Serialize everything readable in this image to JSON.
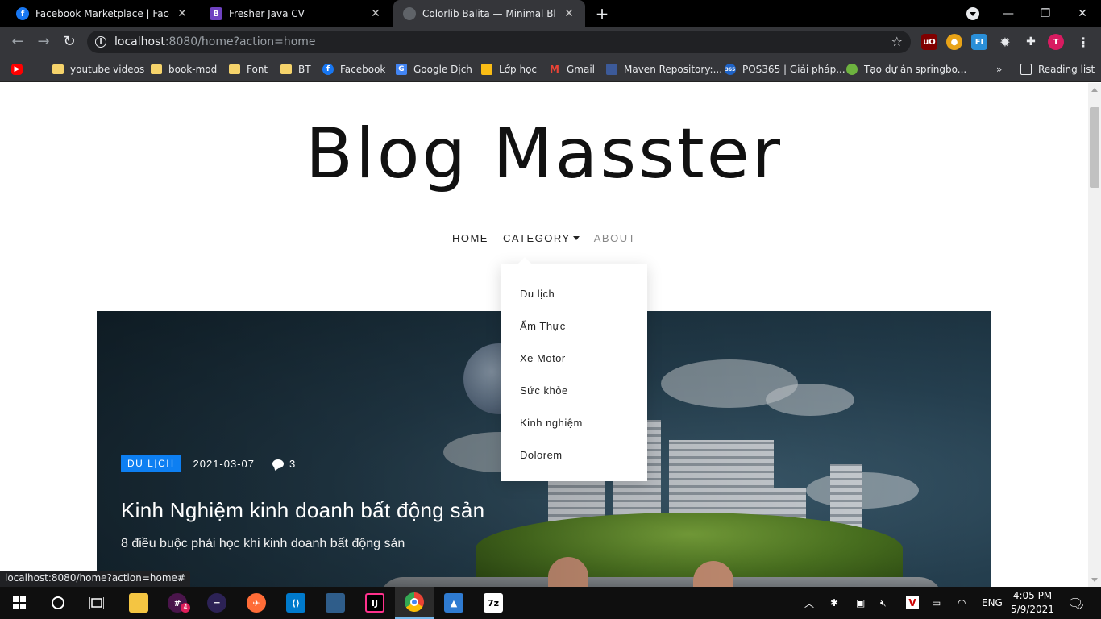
{
  "browser": {
    "tabs": [
      {
        "title": "Facebook Marketplace | Facebook",
        "icon": "facebook-icon",
        "color": "#1877f2",
        "glyph": "f",
        "active": false
      },
      {
        "title": "Fresher Java CV",
        "icon": "bootstrap-icon",
        "color": "#6f42c1",
        "glyph": "B",
        "active": false
      },
      {
        "title": "Colorlib Balita — Minimal Blog Template",
        "icon": "globe-icon",
        "color": "#5f6368",
        "glyph": "",
        "active": true
      }
    ],
    "url_host": "localhost",
    "url_rest": ":8080/home?action=home",
    "bookmarks": [
      {
        "label": "",
        "icon": "youtube-icon"
      },
      {
        "label": "youtube videos",
        "icon": "folder-icon"
      },
      {
        "label": "book-mod",
        "icon": "folder-icon"
      },
      {
        "label": "Font",
        "icon": "folder-icon"
      },
      {
        "label": "BT",
        "icon": "folder-icon"
      },
      {
        "label": "Facebook",
        "icon": "facebook-icon"
      },
      {
        "label": "Google Dịch",
        "icon": "google-translate-icon"
      },
      {
        "label": "Lớp học",
        "icon": "classroom-icon"
      },
      {
        "label": "Gmail",
        "icon": "gmail-icon"
      },
      {
        "label": "Maven Repository:...",
        "icon": "maven-icon"
      },
      {
        "label": "POS365 | Giải pháp...",
        "icon": "pos365-icon"
      },
      {
        "label": "Tạo dự án springbo...",
        "icon": "spring-icon"
      }
    ],
    "more_bookmarks": "»",
    "reading_list": "Reading list",
    "status_url": "localhost:8080/home?action=home#"
  },
  "site": {
    "title": "Blog Masster",
    "nav": {
      "home": "HOME",
      "category": "CATEGORY",
      "about": "ABOUT"
    },
    "category_menu": [
      "Du lịch",
      "Ẩm Thực",
      "Xe Motor",
      "Sức khỏe",
      "Kinh nghiệm",
      "Dolorem"
    ],
    "featured_post": {
      "category": "DU LỊCH",
      "date": "2021-03-07",
      "comments": "3",
      "title": "Kinh Nghiệm kinh doanh bất động sản",
      "excerpt": "8 điều buộc phải học khi kinh doanh bất động sản"
    }
  },
  "taskbar": {
    "apps": [
      {
        "name": "file-explorer-icon",
        "color": "#f4c542"
      },
      {
        "name": "slack-icon",
        "color": "#4a154b"
      },
      {
        "name": "eclipse-icon",
        "color": "#2c2255"
      },
      {
        "name": "postman-icon",
        "color": "#ff6c37"
      },
      {
        "name": "vscode-icon",
        "color": "#007acc"
      },
      {
        "name": "sql-developer-icon",
        "color": "#2f5d8a"
      },
      {
        "name": "intellij-icon",
        "color": "#000000"
      },
      {
        "name": "chrome-icon",
        "color": "#4285f4"
      },
      {
        "name": "photos-icon",
        "color": "#2f7bd1"
      },
      {
        "name": "7zip-icon",
        "color": "#ffffff"
      }
    ],
    "slack_badge": "4",
    "language": "ENG",
    "time": "4:05 PM",
    "date": "5/9/2021",
    "notifications": "2"
  }
}
